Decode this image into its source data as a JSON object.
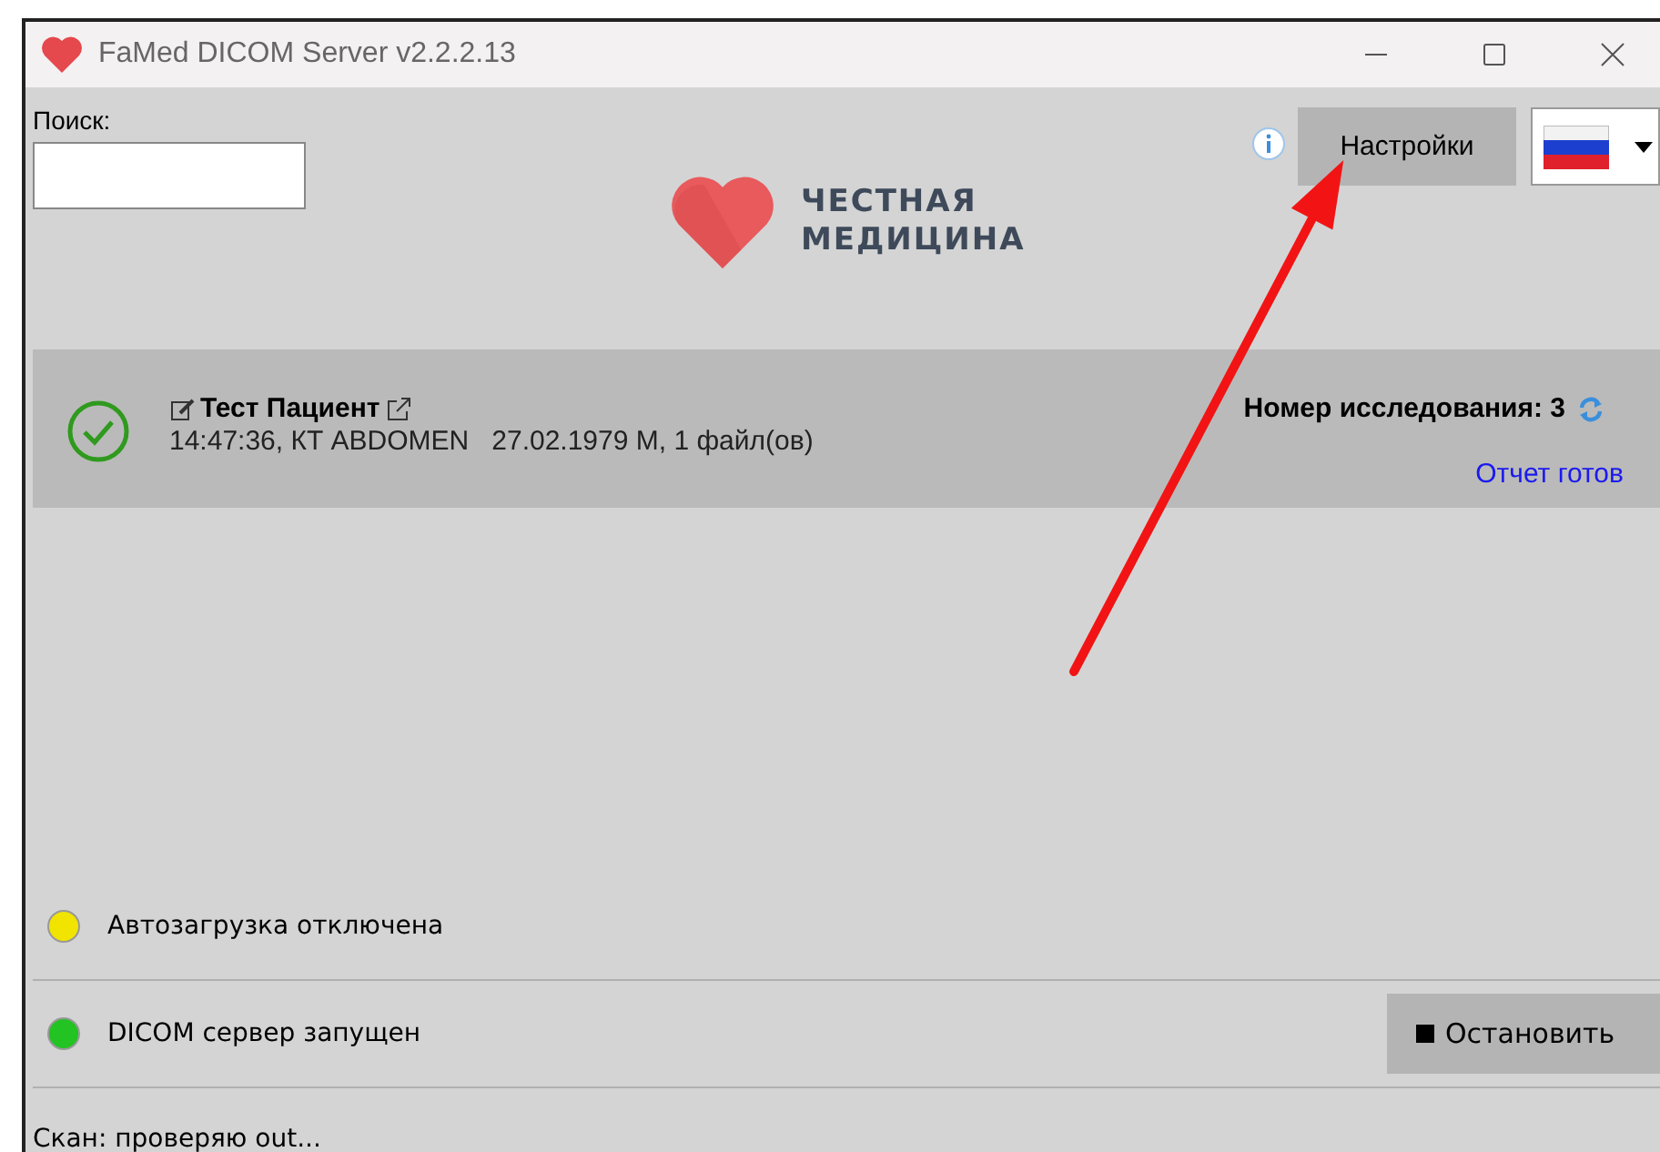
{
  "window": {
    "title": "FaMed DICOM Server v2.2.2.13"
  },
  "search": {
    "label": "Поиск:"
  },
  "logo": {
    "line_1": "ЧЕСТНАЯ",
    "line_2": "МЕДИЦИНА"
  },
  "settings_button": "Настройки",
  "studies": [
    {
      "patient": "Тест Пациент",
      "details": "14:47:36, КТ ABDOMEN   27.02.1979 М, 1 файл(ов)",
      "study_number": "Номер исследования: 3",
      "report": "Отчет готов",
      "done": true
    }
  ],
  "statuses": [
    {
      "text": "Автозагрузка отключена",
      "color": "#f0e400"
    },
    {
      "text": "DICOM сервер запущен",
      "color": "#22c322",
      "button": "Остановить"
    }
  ],
  "status_bar": "Скан: проверяю out..."
}
